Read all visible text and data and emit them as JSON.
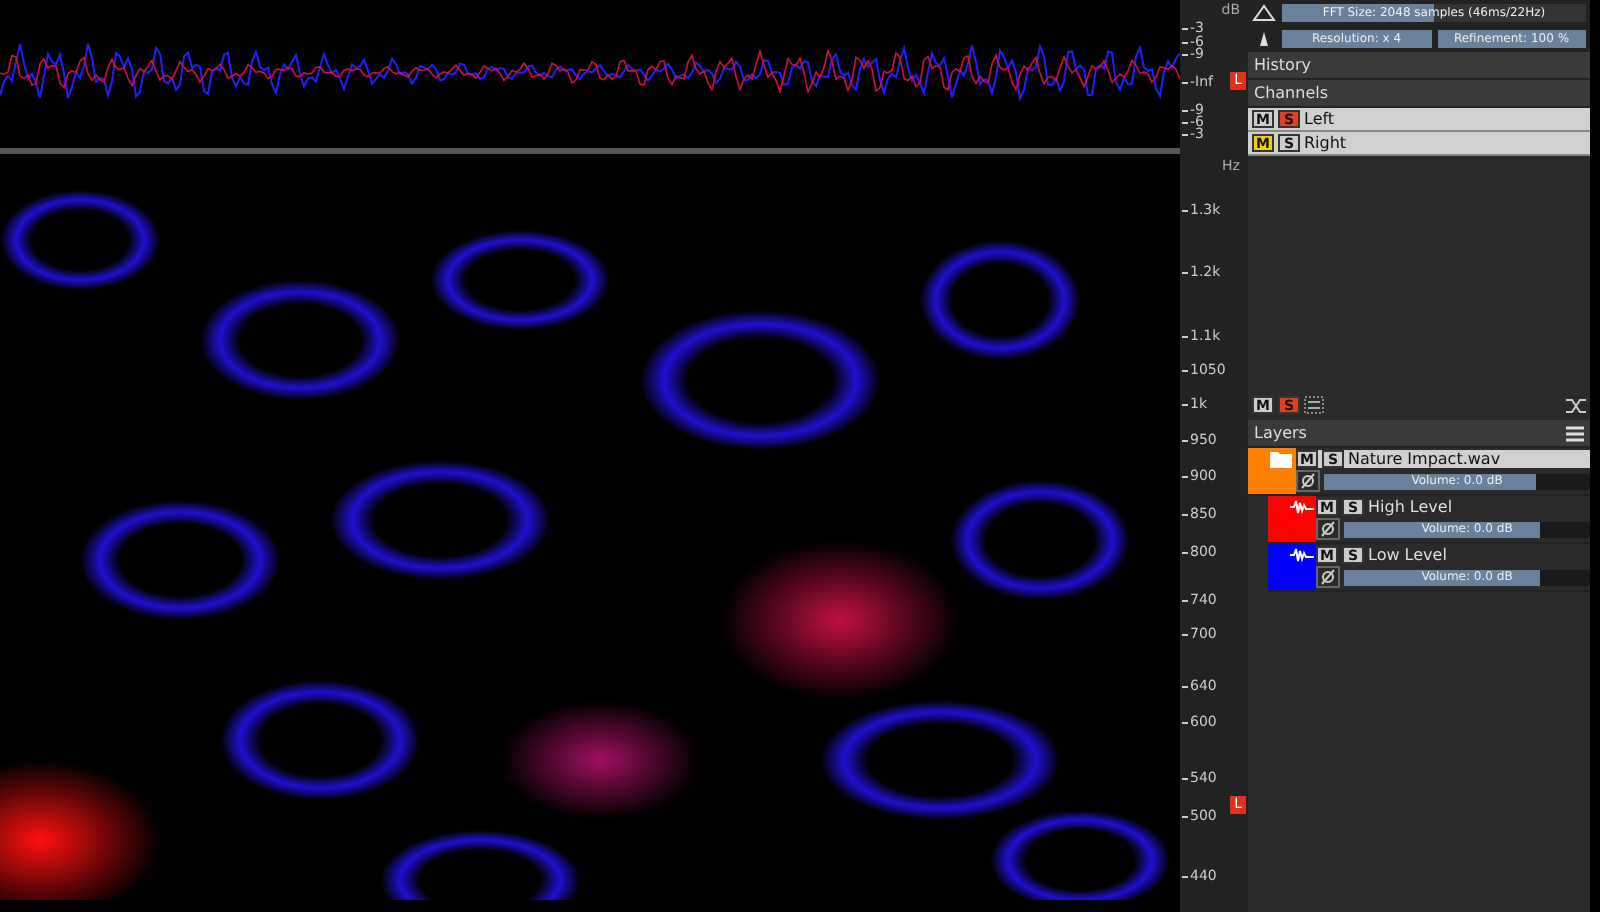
{
  "db_scale": {
    "unit": "dB",
    "ticks": [
      "-3",
      "-6",
      "-9",
      "-Inf",
      "-9",
      "-6",
      "-3"
    ],
    "channel_badge": "L"
  },
  "hz_scale": {
    "unit": "Hz",
    "ticks": [
      "1.3k",
      "1.2k",
      "1.1k",
      "1050",
      "1k",
      "950",
      "900",
      "850",
      "800",
      "740",
      "700",
      "640",
      "600",
      "540",
      "500",
      "440"
    ],
    "channel_badge": "L"
  },
  "toolbar": {
    "fft": {
      "label": "FFT Size: 2048 samples (46ms/22Hz)",
      "level": 0.5
    },
    "resolution": {
      "label": "Resolution: x 4",
      "level": 1
    },
    "refinement": {
      "label": "Refinement: 100 %",
      "level": 1
    }
  },
  "history": {
    "title": "History"
  },
  "channels": {
    "title": "Channels",
    "items": [
      {
        "name": "Left",
        "mute_label": "M",
        "solo_label": "S",
        "muted": false,
        "solo": true
      },
      {
        "name": "Right",
        "mute_label": "M",
        "solo_label": "S",
        "muted": true,
        "solo": false
      }
    ]
  },
  "layer_toolbar": {
    "mute_label": "M",
    "solo_label": "S",
    "muted": false,
    "solo": true
  },
  "layers": {
    "title": "Layers",
    "items": [
      {
        "kind": "file",
        "name": "Nature Impact.wav",
        "color": "#ff8000",
        "mute_label": "M",
        "solo_label": "S",
        "muted": false,
        "solo": false,
        "volume": "Volume: 0.0 dB",
        "level": 0.8,
        "children": [
          {
            "kind": "layer",
            "name": "High Level",
            "color": "#ff0000",
            "mute_label": "M",
            "solo_label": "S",
            "muted": false,
            "solo": false,
            "volume": "Volume: 0.0 dB",
            "level": 0.8
          },
          {
            "kind": "layer",
            "name": "Low Level",
            "color": "#0000ff",
            "mute_label": "M",
            "solo_label": "S",
            "muted": false,
            "solo": false,
            "volume": "Volume: 0.0 dB",
            "level": 0.8
          }
        ]
      }
    ]
  }
}
